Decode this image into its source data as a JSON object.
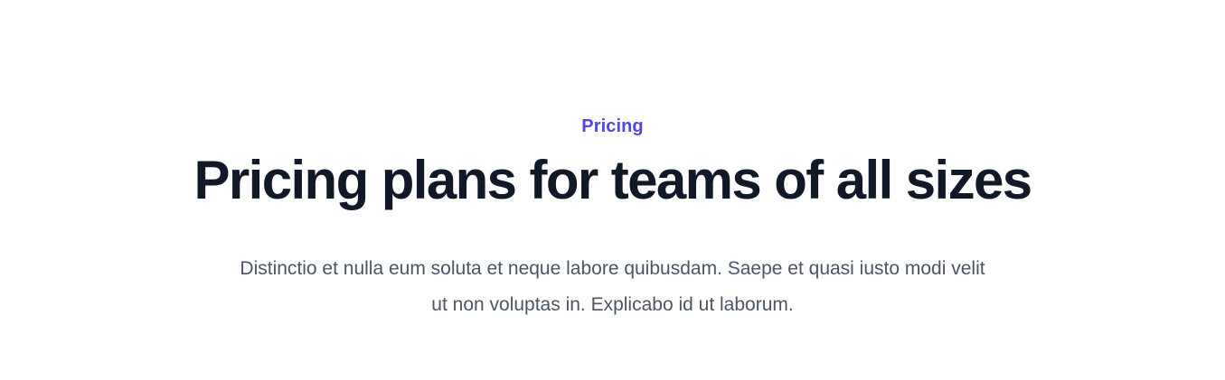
{
  "pricing_header": {
    "eyebrow": "Pricing",
    "title": "Pricing plans for teams of all sizes",
    "description": "Distinctio et nulla eum soluta et neque labore quibusdam. Saepe et quasi iusto modi velit ut non voluptas in. Explicabo id ut laborum."
  },
  "colors": {
    "accent": "#4f46e5",
    "heading": "#111827",
    "body_text": "#4b5563",
    "background": "#ffffff"
  }
}
